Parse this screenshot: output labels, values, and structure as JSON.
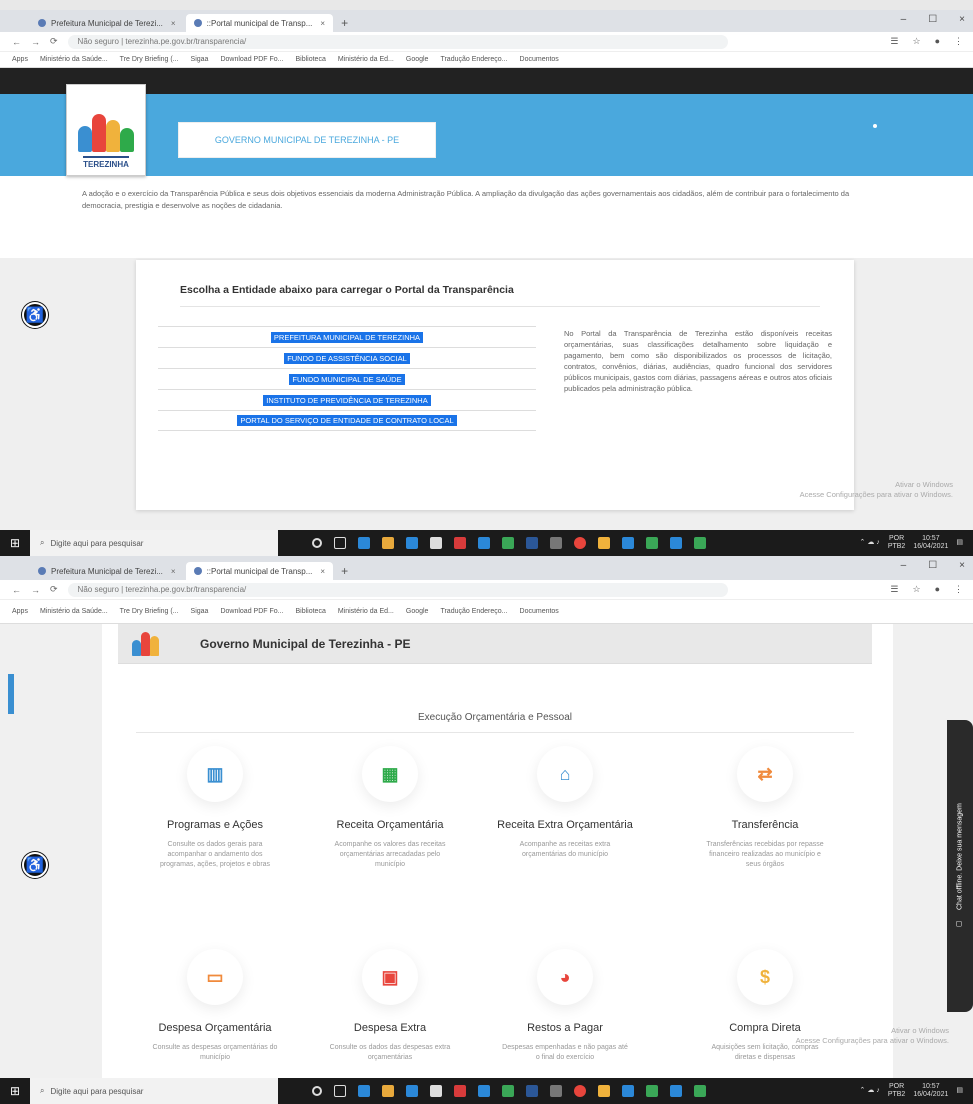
{
  "browser": {
    "tabs": [
      {
        "label": "Prefeitura Municipal de Terezi..."
      },
      {
        "label": "::Portal municipal de Transp..."
      }
    ],
    "url": "Não seguro | terezinha.pe.gov.br/transparencia/",
    "bookmarks": [
      "Apps",
      "Ministério da Saúde...",
      "Tre Dry Briefing (...",
      "Sigaa",
      "Download PDF Fo...",
      "Biblioteca",
      "Ministério da Ed...",
      "Google",
      "Tradução Endereço...",
      "Documentos"
    ]
  },
  "page1": {
    "logo_text": "TEREZINHA",
    "gov_button": "GOVERNO MUNICIPAL DE TEREZINHA - PE",
    "intro": "A adoção e o exercício da Transparência Pública e seus dois objetivos essenciais da moderna Administração Pública. A ampliação da divulgação das ações governamentais aos cidadãos, além de contribuir para o fortalecimento da democracia, prestigia e desenvolve as noções de cidadania.",
    "card_title": "Escolha a Entidade abaixo para carregar o Portal da Transparência",
    "entities": [
      "PREFEITURA MUNICIPAL DE TEREZINHA",
      "FUNDO DE ASSISTÊNCIA SOCIAL",
      "FUNDO MUNICIPAL DE SAÚDE",
      "INSTITUTO DE PREVIDÊNCIA DE TEREZINHA",
      "PORTAL DO SERVIÇO DE ENTIDADE DE CONTRATO LOCAL"
    ],
    "card_text": "No Portal da Transparência de Terezinha estão disponíveis receitas orçamentárias, suas classificações detalhamento sobre liquidação e pagamento, bem como são disponibilizados os processos de licitação, contratos, convênios, diárias, audiências, quadro funcional dos servidores públicos municipais, gastos com diárias, passagens aéreas e outros atos oficiais publicados pela administração pública.",
    "watermark_title": "Ativar o Windows",
    "watermark_sub": "Acesse Configurações para ativar o Windows."
  },
  "page2": {
    "header_title": "Governo Municipal de Terezinha - PE",
    "section_title": "Execução Orçamentária e Pessoal",
    "services": [
      {
        "title": "Programas e Ações",
        "desc": "Consulte os dados gerais para acompanhar o andamento dos programas, ações, projetos e obras",
        "icon": "chart-icon",
        "color": "#3a8fd1"
      },
      {
        "title": "Receita Orçamentária",
        "desc": "Acompanhe os valores das receitas orçamentárias arrecadadas pelo município",
        "icon": "money-icon",
        "color": "#2eaa4a"
      },
      {
        "title": "Receita Extra Orçamentária",
        "desc": "Acompanhe as receitas extra orçamentárias do município",
        "icon": "bank-icon",
        "color": "#3a8fd1"
      },
      {
        "title": "Transferência",
        "desc": "Transferências recebidas por repasse financeiro realizadas ao município e seus órgãos",
        "icon": "transfer-icon",
        "color": "#f08a3c"
      },
      {
        "title": "Despesa Orçamentária",
        "desc": "Consulte as despesas orçamentárias do município",
        "icon": "wallet-icon",
        "color": "#f08a3c"
      },
      {
        "title": "Despesa Extra",
        "desc": "Consulte os dados das despesas extra orçamentárias",
        "icon": "payment-icon",
        "color": "#e8453c"
      },
      {
        "title": "Restos a Pagar",
        "desc": "Despesas empenhadas e não pagas até o final do exercício",
        "icon": "pie-icon",
        "color": "#e8453c"
      },
      {
        "title": "Compra Direta",
        "desc": "Aquisições sem licitação, compras diretas e dispensas",
        "icon": "dollar-icon",
        "color": "#f0b23c"
      }
    ],
    "side_tab": "Chat offline. Deixe sua mensagem",
    "watermark_title": "Ativar o Windows",
    "watermark_sub": "Acesse Configurações para ativar o Windows."
  },
  "taskbar": {
    "search_placeholder": "Digite aqui para pesquisar",
    "lang": "POR",
    "lang_sub": "PTB2",
    "time": "10:57",
    "date": "16/04/2021"
  }
}
